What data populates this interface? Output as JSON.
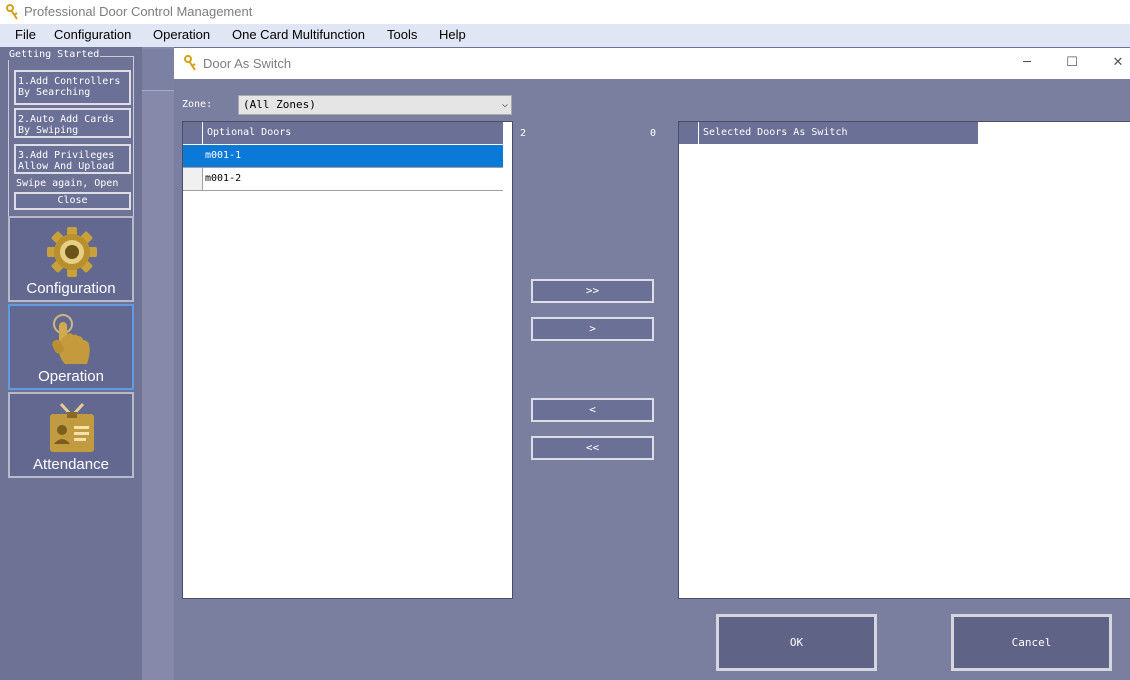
{
  "app": {
    "title": "Professional Door Control Management"
  },
  "menu": {
    "items": [
      "File",
      "Configuration",
      "Operation",
      "One Card Multifunction",
      "Tools",
      "Help"
    ]
  },
  "sidebar": {
    "getting_started": {
      "legend": "Getting Started",
      "steps": [
        {
          "line1": "1.Add Controllers",
          "line2": "By Searching"
        },
        {
          "line1": "2.Auto Add Cards",
          "line2": "By Swiping"
        },
        {
          "line1": "3.Add Privileges",
          "line2": "Allow And Upload"
        }
      ],
      "swipe_text": "Swipe again, Open",
      "close_label": "Close"
    },
    "nav": [
      {
        "label": "Configuration",
        "icon": "gear-icon"
      },
      {
        "label": "Operation",
        "icon": "hand-pointer-icon",
        "active": true
      },
      {
        "label": "Attendance",
        "icon": "id-badge-icon"
      }
    ]
  },
  "dialog": {
    "title": "Door As Switch",
    "controls": {
      "minimize": "─",
      "maximize": "☐",
      "close": "✕"
    },
    "zone": {
      "label": "Zone:",
      "selected": "(All Zones)"
    },
    "optional": {
      "header": "Optional Doors",
      "count": "2",
      "rows": [
        "m001-1",
        "m001-2"
      ],
      "selected_index": 0
    },
    "selected": {
      "header": "Selected Doors As Switch",
      "count": "0",
      "rows": []
    },
    "transfer_buttons": {
      "add_all": ">>",
      "add_one": ">",
      "remove_one": "<",
      "remove_all": "<<"
    },
    "ok_label": "OK",
    "cancel_label": "Cancel"
  },
  "colors": {
    "background": "#6e7396",
    "panel": "#7b7f9f",
    "selection": "#0b79d8",
    "menubar": "#e1e6f5"
  }
}
